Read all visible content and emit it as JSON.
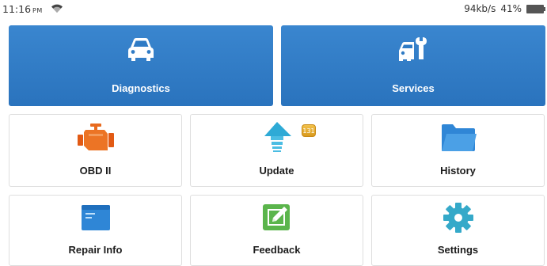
{
  "status_bar": {
    "time": "11:16",
    "ampm": "PM",
    "speed": "94kb/s",
    "battery": "41%",
    "icons": [
      "wifi-icon",
      "battery-icon"
    ]
  },
  "tiles": {
    "diagnostics": {
      "label": "Diagnostics",
      "icon": "car-icon"
    },
    "services": {
      "label": "Services",
      "icon": "car-wrench-icon"
    },
    "obd": {
      "label": "OBD II",
      "icon": "engine-icon"
    },
    "update": {
      "label": "Update",
      "icon": "upload-arrow-icon",
      "badge": "131"
    },
    "history": {
      "label": "History",
      "icon": "folder-icon"
    },
    "repair_info": {
      "label": "Repair Info",
      "icon": "document-icon"
    },
    "feedback": {
      "label": "Feedback",
      "icon": "edit-icon"
    },
    "settings": {
      "label": "Settings",
      "icon": "gear-icon"
    }
  },
  "colors": {
    "primary_tile": "#2f7bc5",
    "tile_border": "#dedede",
    "engine": "#e86a1e",
    "update": "#2eaad6",
    "folder": "#2f86d6",
    "feedback": "#5bb54c",
    "gear": "#35a9c9",
    "badge": "#e6ac2f"
  }
}
